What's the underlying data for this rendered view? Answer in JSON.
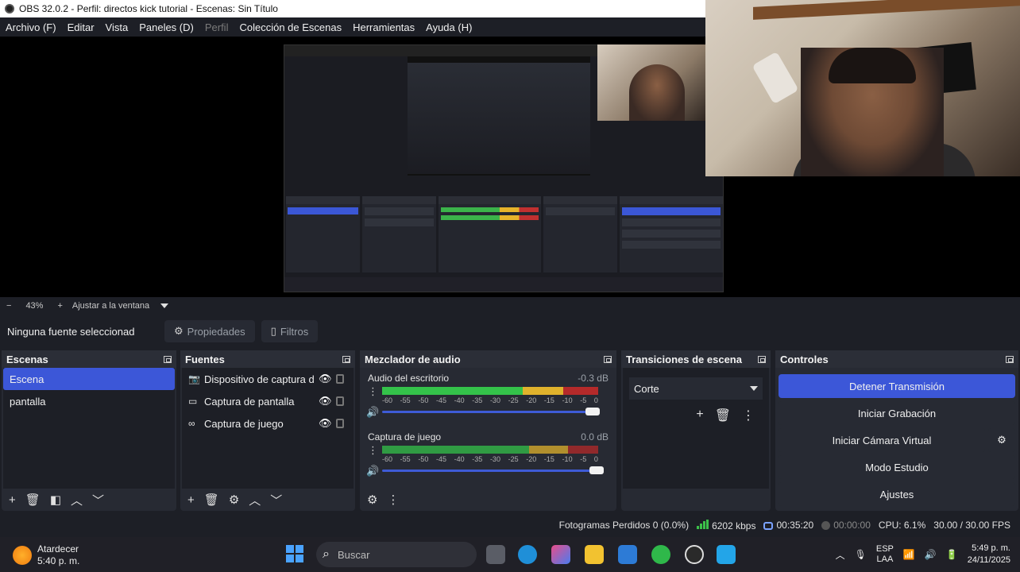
{
  "window": {
    "title": "OBS 32.0.2 - Perfil: directos kick tutorial - Escenas: Sin Título"
  },
  "menu": [
    "Archivo (F)",
    "Editar",
    "Vista",
    "Paneles (D)",
    "Perfil",
    "Colección de Escenas",
    "Herramientas",
    "Ayuda (H)"
  ],
  "zoom": {
    "minus": "−",
    "value": "43%",
    "plus": "+",
    "fit": "Ajustar a la ventana"
  },
  "source_bar": {
    "no_selection": "Ninguna fuente seleccionad",
    "properties": "Propiedades",
    "filters": "Filtros"
  },
  "scenes": {
    "title": "Escenas",
    "items": [
      {
        "label": "Escena",
        "selected": true
      },
      {
        "label": "pantalla",
        "selected": false
      }
    ]
  },
  "sources": {
    "title": "Fuentes",
    "items": [
      {
        "label": "Dispositivo de captura d",
        "icon": "camera-icon"
      },
      {
        "label": "Captura de pantalla",
        "icon": "monitor-icon"
      },
      {
        "label": "Captura de juego",
        "icon": "gamepad-icon"
      }
    ]
  },
  "mixer": {
    "title": "Mezclador de audio",
    "channels": [
      {
        "name": "Audio del escritorio",
        "db": "-0.3 dB",
        "ticks": [
          "-60",
          "-55",
          "-50",
          "-45",
          "-40",
          "-35",
          "-30",
          "-25",
          "-20",
          "-15",
          "-10",
          "-5",
          "0"
        ]
      },
      {
        "name": "Captura de juego",
        "db": "0.0 dB",
        "ticks": [
          "-60",
          "-55",
          "-50",
          "-45",
          "-40",
          "-35",
          "-30",
          "-25",
          "-20",
          "-15",
          "-10",
          "-5",
          "0"
        ]
      }
    ]
  },
  "transitions": {
    "title": "Transiciones de escena",
    "selected": "Corte"
  },
  "controls": {
    "title": "Controles",
    "stop_stream": "Detener Transmisión",
    "start_recording": "Iniciar Grabación",
    "start_virtual_cam": "Iniciar Cámara Virtual",
    "studio_mode": "Modo Estudio",
    "settings": "Ajustes"
  },
  "status": {
    "dropped": "Fotogramas Perdidos 0 (0.0%)",
    "bitrate": "6202 kbps",
    "stream_time": "00:35:20",
    "rec_time": "00:00:00",
    "cpu": "CPU: 6.1%",
    "fps": "30.00 / 30.00 FPS"
  },
  "taskbar": {
    "weather_label": "Atardecer",
    "weather_time": "5:40 p. m.",
    "search_placeholder": "Buscar",
    "lang_top": "ESP",
    "lang_bottom": "LAA",
    "clock_time": "5:49 p. m.",
    "clock_date": "24/11/2025"
  },
  "colors": {
    "accent": "#3c57d8",
    "meter_green": "#34c24a",
    "meter_yellow": "#e0b22c",
    "meter_red": "#b52a2a"
  }
}
